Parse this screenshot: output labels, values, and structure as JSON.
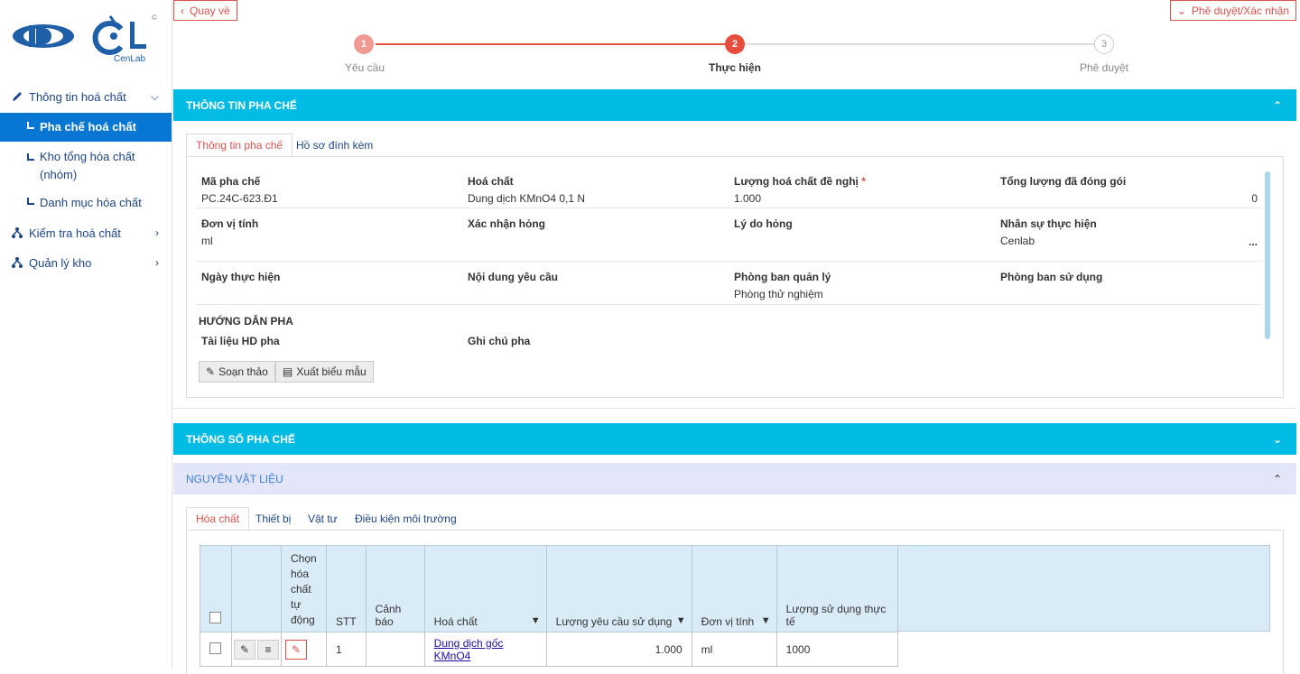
{
  "sidebar": {
    "logo_text": "CenLab",
    "items": [
      {
        "label": "Thông tin hoá chất"
      },
      {
        "label": "Pha chế hoá chất"
      },
      {
        "label": "Kho tổng hóa chất (nhóm)"
      },
      {
        "label": "Danh mục hóa chất"
      },
      {
        "label": "Kiểm tra hoá chất"
      },
      {
        "label": "Quản lý kho"
      }
    ]
  },
  "header": {
    "back_label": "Quay về",
    "approve_label": "Phê duyệt/Xác nhận"
  },
  "steps": [
    {
      "num": "1",
      "label": "Yêu cầu",
      "state": "done"
    },
    {
      "num": "2",
      "label": "Thực hiện",
      "state": "current"
    },
    {
      "num": "3",
      "label": "Phê duyệt",
      "state": "pending"
    }
  ],
  "section1": {
    "title": "THÔNG TIN PHA CHẾ",
    "tabs": [
      "Thông tin pha chế",
      "Hồ sơ đính kèm"
    ],
    "fields": {
      "ma_pha_che": {
        "label": "Mã pha chế",
        "value": "PC.24C-623.Đ1"
      },
      "hoa_chat": {
        "label": "Hoá chất",
        "value": "Dung dịch KMnO4 0,1 N"
      },
      "luong_de_nghi": {
        "label": "Lượng hoá chất đề nghị",
        "required": "*",
        "value": "1.000"
      },
      "tong_luong": {
        "label": "Tổng lượng đã đóng gói",
        "value": "0"
      },
      "don_vi_tinh": {
        "label": "Đơn vị tính",
        "value": "ml"
      },
      "xac_nhan_hong": {
        "label": "Xác nhận hỏng",
        "value": ""
      },
      "ly_do_hong": {
        "label": "Lý do hỏng",
        "value": ""
      },
      "nhan_su": {
        "label": "Nhân sự thực hiện",
        "value": "Cenlab",
        "more": "..."
      },
      "ngay_thuc_hien": {
        "label": "Ngày thực hiện",
        "value": ""
      },
      "noi_dung": {
        "label": "Nội dung yêu cầu",
        "value": ""
      },
      "phong_ban_ql": {
        "label": "Phòng ban quản lý",
        "value": "Phòng thử nghiệm"
      },
      "phong_ban_sd": {
        "label": "Phòng ban sử dụng",
        "value": ""
      }
    },
    "guide_title": "HƯỚNG DẪN PHA",
    "tai_lieu_label": "Tài liệu HD pha",
    "ghi_chu_label": "Ghi chú pha",
    "btn_edit": "Soạn thảo",
    "btn_export": "Xuất biểu mẫu"
  },
  "section2": {
    "title": "THÔNG SỐ PHA CHẾ"
  },
  "section3": {
    "title": "NGUYÊN VẬT LIỆU",
    "tabs": [
      "Hóa chất",
      "Thiết bị",
      "Vật tư",
      "Điều kiện môi trường"
    ],
    "table": {
      "headers": {
        "chon": "Chọn hóa chất tự động",
        "stt": "STT",
        "canh_bao": "Cảnh báo",
        "hoa_chat": "Hoá chất",
        "luong_yc": "Lượng yêu cầu sử dụng",
        "don_vi": "Đơn vị tính",
        "luong_tt": "Lượng sử dụng thực tế"
      },
      "rows": [
        {
          "stt": "1",
          "canh_bao": "",
          "hoa_chat": "Dung dịch gốc KMnO4",
          "luong_yc": "1.000",
          "don_vi": "ml",
          "luong_tt": "1000"
        }
      ]
    }
  },
  "colors": {
    "accent_bar": "#00bce4",
    "active_nav": "#0876d3",
    "danger": "#d9534f",
    "link": "#1c4587"
  }
}
